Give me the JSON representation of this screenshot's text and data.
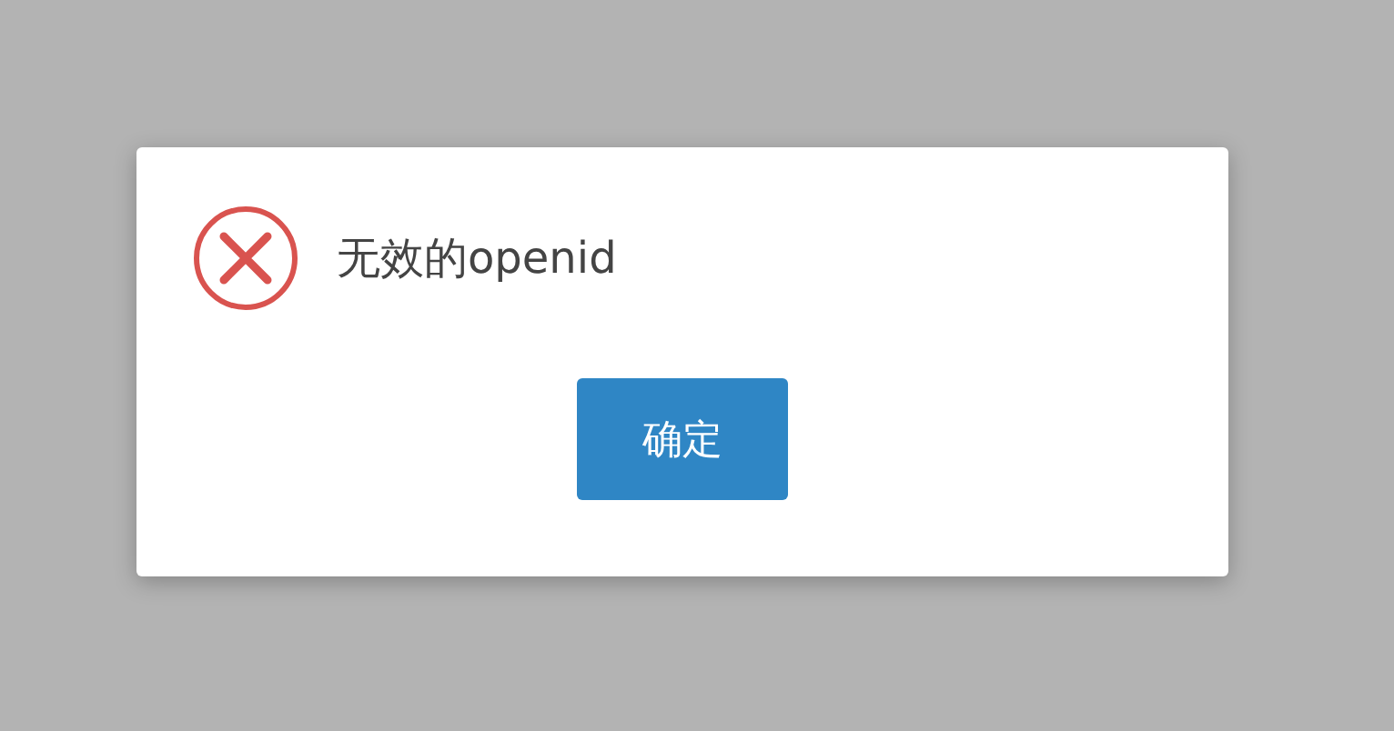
{
  "dialog": {
    "kind": "error",
    "message": "无效的openid",
    "buttons": [
      {
        "label": "确定"
      }
    ]
  }
}
